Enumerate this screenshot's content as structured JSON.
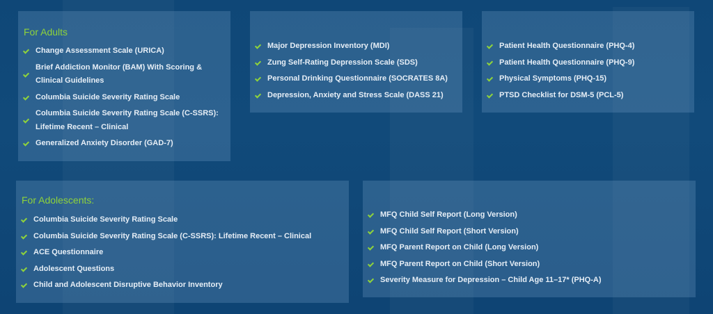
{
  "adults": {
    "heading": "For Adults",
    "col1": [
      "Change Assessment Scale (URICA)",
      "Brief Addiction Monitor (BAM) With Scoring & Clinical Guidelines",
      "Columbia Suicide Severity Rating Scale",
      "Columbia Suicide Severity Rating Scale (C-SSRS): Lifetime Recent – Clinical",
      "Generalized Anxiety Disorder (GAD-7)"
    ],
    "col2": [
      "Major Depression Inventory (MDI)",
      "Zung Self-Rating Depression Scale (SDS)",
      "Personal Drinking Questionnaire (SOCRATES 8A)",
      "Depression, Anxiety and Stress Scale (DASS 21)"
    ],
    "col3": [
      "Patient Health Questionnaire (PHQ-4)",
      "Patient Health Questionnaire (PHQ-9)",
      "Physical Symptoms (PHQ-15)",
      "PTSD Checklist for DSM-5 (PCL-5)"
    ]
  },
  "adolescents": {
    "heading": "For Adolescents:",
    "col1": [
      "Columbia Suicide Severity Rating Scale",
      "Columbia Suicide Severity Rating Scale (C-SSRS): Lifetime Recent – Clinical",
      "ACE Questionnaire",
      "Adolescent Questions",
      "Child and Adolescent Disruptive Behavior Inventory"
    ],
    "col2": [
      "MFQ Child Self Report (Long Version)",
      "MFQ Child Self Report (Short Version)",
      "MFQ Parent Report on Child (Long Version)",
      "MFQ Parent Report on Child (Short Version)",
      "Severity Measure for Depression – Child Age 11–17* (PHQ-A)"
    ]
  },
  "colors": {
    "accent": "#8fd33b",
    "text": "#e6eef6",
    "background": "#0f4777"
  },
  "icons": {
    "bullet": "check-icon"
  }
}
